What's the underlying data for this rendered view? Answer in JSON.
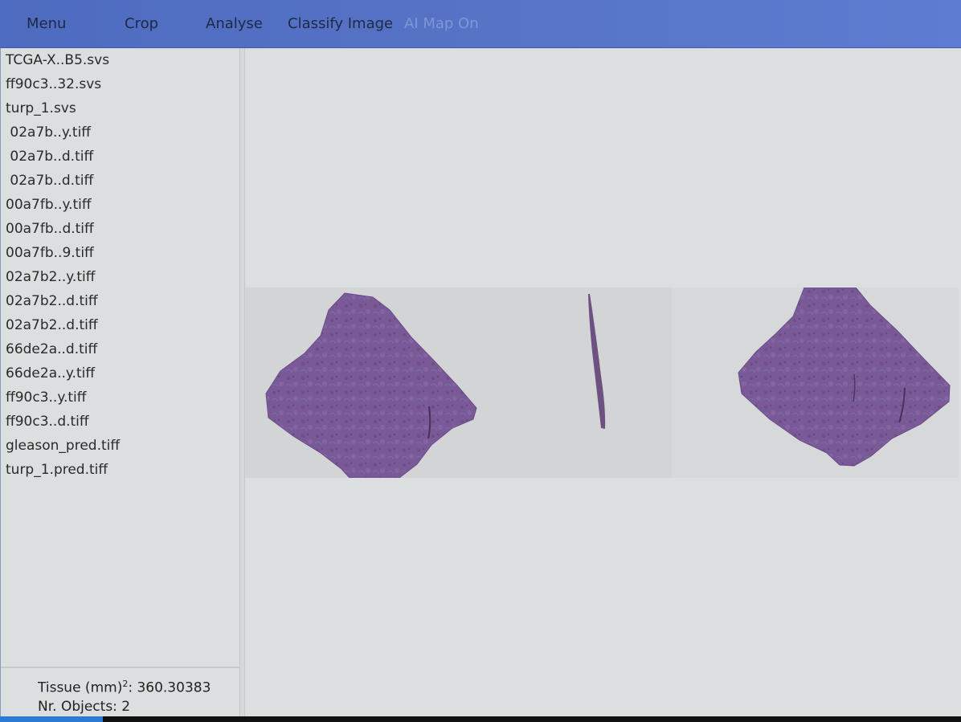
{
  "menu": {
    "items": [
      {
        "label": "Menu"
      },
      {
        "label": "Crop"
      },
      {
        "label": "Analyse"
      },
      {
        "label": "Classify Image"
      },
      {
        "label": "AI Map On"
      }
    ]
  },
  "sidebar": {
    "files": [
      "TCGA-X..B5.svs",
      "ff90c3..32.svs",
      "turp_1.svs",
      " 02a7b..y.tiff",
      " 02a7b..d.tiff",
      " 02a7b..d.tiff",
      "00a7fb..y.tiff",
      "00a7fb..d.tiff",
      "00a7fb..9.tiff",
      "02a7b2..y.tiff",
      "02a7b2..d.tiff",
      "02a7b2..d.tiff",
      "66de2a..d.tiff",
      "66de2a..y.tiff",
      "ff90c3..y.tiff",
      "ff90c3..d.tiff",
      "gleason_pred.tiff",
      "turp_1.pred.tiff"
    ],
    "stats": {
      "tissue_label": "Tissue (mm)",
      "tissue_sup": "2",
      "tissue_value": ": 360.30383",
      "objects": "Nr. Objects: 2"
    }
  },
  "colors": {
    "menubar": "#5673c6",
    "tissue": "#7a5a96",
    "progress": "#2c7ad1"
  },
  "progress": {
    "fraction": 0.107
  }
}
